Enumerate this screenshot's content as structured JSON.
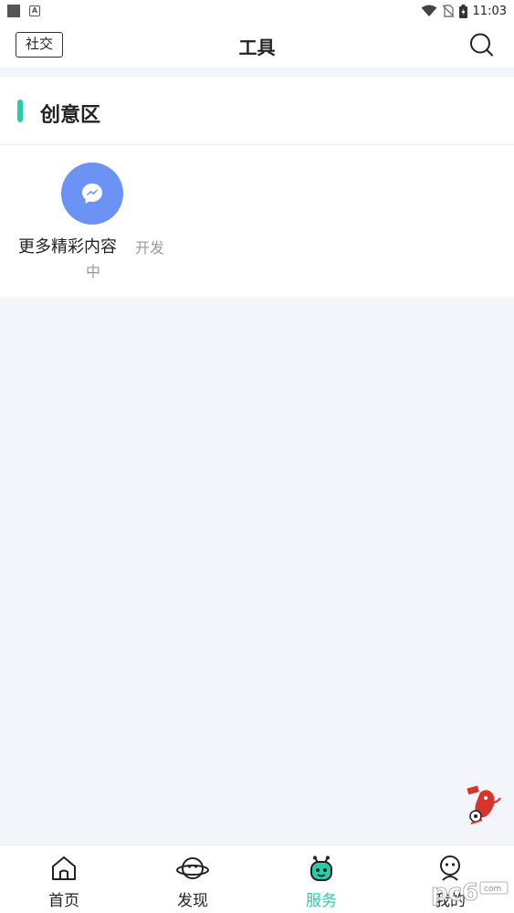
{
  "status_bar": {
    "time": "11:03"
  },
  "header": {
    "social_label": "社交",
    "title": "工具",
    "search_icon": "search-icon"
  },
  "section": {
    "title": "创意区",
    "accent_color": "#2ec9a7",
    "items": [
      {
        "label": "更多精彩内容",
        "status_line1": "开发",
        "status_line2": "中",
        "icon": "chat-bubble-icon",
        "icon_bg": "#6b93f5"
      }
    ]
  },
  "bottom_nav": {
    "items": [
      {
        "label": "首页",
        "icon": "home-icon",
        "active": false
      },
      {
        "label": "发现",
        "icon": "planet-icon",
        "active": false
      },
      {
        "label": "服务",
        "icon": "robot-icon",
        "active": true
      },
      {
        "label": "我的",
        "icon": "person-icon",
        "active": false
      }
    ],
    "active_color": "#2ec9a7"
  },
  "watermark": {
    "logo_text": "pc6",
    "logo_sub": "com"
  }
}
